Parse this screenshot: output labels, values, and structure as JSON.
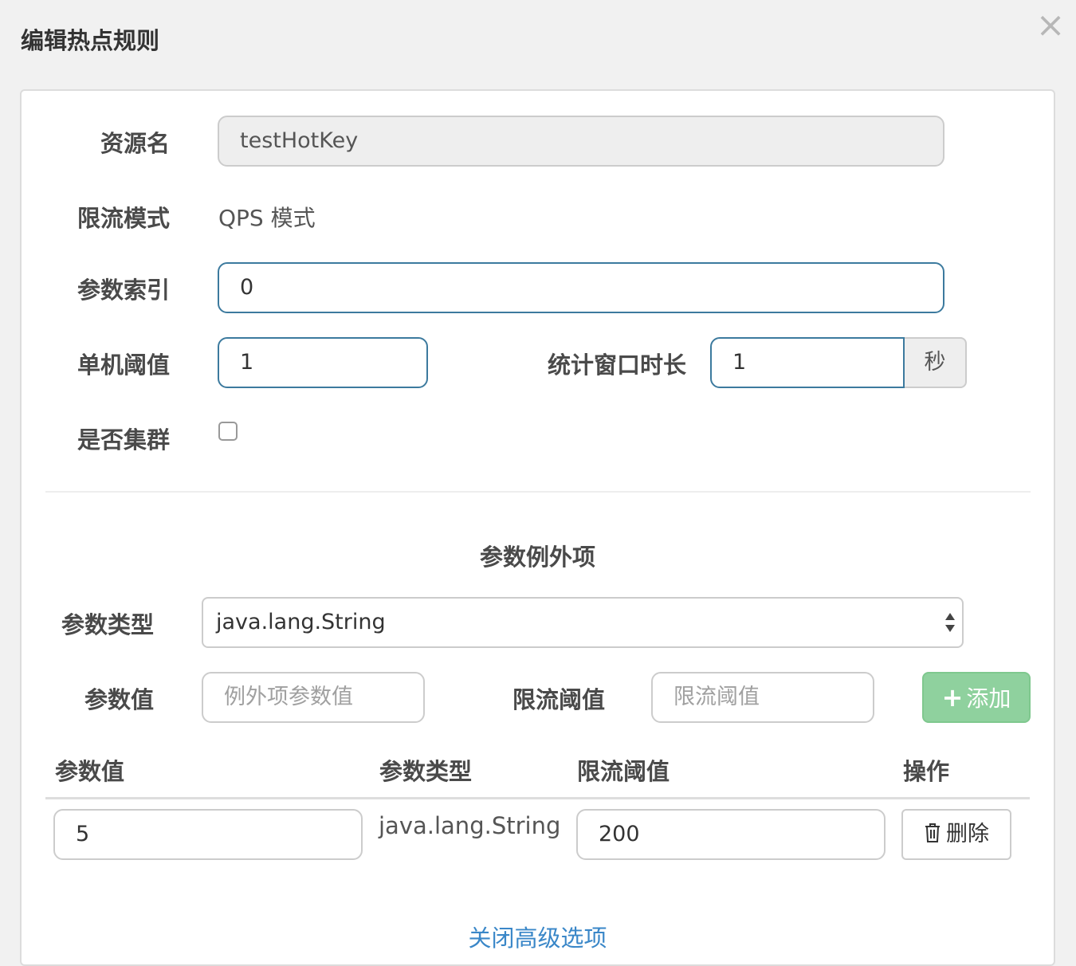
{
  "dialog": {
    "title": "编辑热点规则"
  },
  "form": {
    "resource_label": "资源名",
    "resource_value": "testHotKey",
    "mode_label": "限流模式",
    "mode_value": "QPS 模式",
    "param_index_label": "参数索引",
    "param_index_value": "0",
    "threshold_label": "单机阈值",
    "threshold_value": "1",
    "window_label": "统计窗口时长",
    "window_value": "1",
    "window_unit": "秒",
    "cluster_label": "是否集群"
  },
  "exceptions": {
    "section_title": "参数例外项",
    "param_type_label": "参数类型",
    "param_type_selected": "java.lang.String",
    "param_value_label": "参数值",
    "param_value_placeholder": "例外项参数值",
    "limit_label": "限流阈值",
    "limit_placeholder": "限流阈值",
    "add_label": "添加"
  },
  "table": {
    "headers": [
      "参数值",
      "参数类型",
      "限流阈值",
      "操作"
    ],
    "rows": [
      {
        "param_value": "5",
        "param_type": "java.lang.String",
        "limit": "200",
        "delete_label": "删除"
      }
    ]
  },
  "footer": {
    "advanced_link": "关闭高级选项"
  },
  "colors": {
    "accent": "#3c7a9e",
    "add_button": "#8fd19e",
    "link": "#3a87c8"
  }
}
